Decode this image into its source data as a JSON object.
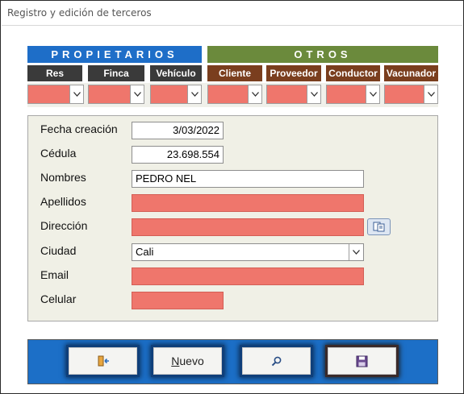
{
  "window": {
    "title": "Registro y edición de terceros"
  },
  "groups": {
    "propietarios": "PROPIETARIOS",
    "otros": "OTROS"
  },
  "tabs": [
    {
      "label": "Res"
    },
    {
      "label": "Finca"
    },
    {
      "label": "Vehículo"
    },
    {
      "label": "Cliente"
    },
    {
      "label": "Proveedor"
    },
    {
      "label": "Conductor"
    },
    {
      "label": "Vacunador"
    }
  ],
  "form": {
    "fecha_label": "Fecha creación",
    "fecha_value": "3/03/2022",
    "cedula_label": "Cédula",
    "cedula_value": "23.698.554",
    "nombres_label": "Nombres",
    "nombres_value": "PEDRO NEL",
    "apellidos_label": "Apellidos",
    "apellidos_value": "",
    "direccion_label": "Dirección",
    "direccion_value": "",
    "ciudad_label": "Ciudad",
    "ciudad_value": "Cali",
    "email_label": "Email",
    "email_value": "",
    "celular_label": "Celular",
    "celular_value": ""
  },
  "toolbar": {
    "exit_icon": "exit-door-icon",
    "nuevo_label_first": "N",
    "nuevo_label_rest": "uevo",
    "search_icon": "magnifier-icon",
    "save_icon": "floppy-save-icon"
  },
  "colors": {
    "propietarios": "#1e6ec8",
    "otros": "#6b8a3c",
    "required_field": "#ef766c",
    "toolbar": "#1c6fc7"
  }
}
